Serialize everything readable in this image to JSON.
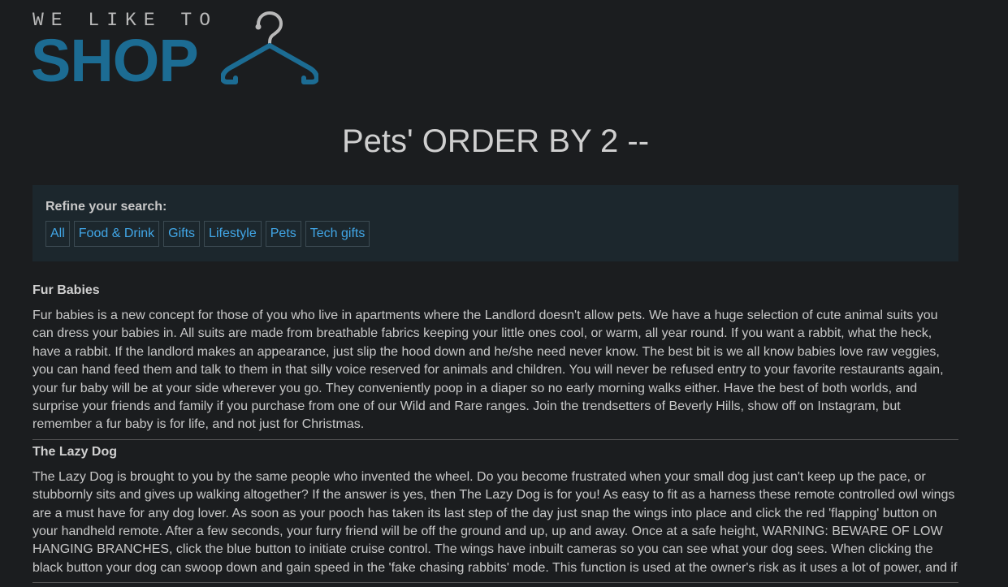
{
  "logo": {
    "tagline": "WE LIKE TO",
    "word": "SHOP"
  },
  "page_title": "Pets' ORDER BY 2 --",
  "refine": {
    "title": "Refine your search:",
    "filters": [
      "All",
      "Food & Drink",
      "Gifts",
      "Lifestyle",
      "Pets",
      "Tech gifts"
    ]
  },
  "products": [
    {
      "name": "Fur Babies",
      "description": "Fur babies is a new concept for those of you who live in apartments where the Landlord doesn't allow pets. We have a huge selection of cute animal suits you can dress your babies in. All suits are made from breathable fabrics keeping your little ones cool, or warm, all year round. If you want a rabbit, what the heck, have a rabbit. If the landlord makes an appearance, just slip the hood down and he/she need never know. The best bit is we all know babies love raw veggies, you can hand feed them and talk to them in that silly voice reserved for animals and children. You will never be refused entry to your favorite restaurants again, your fur baby will be at your side wherever you go. They conveniently poop in a diaper so no early morning walks either. Have the best of both worlds, and surprise your friends and family if you purchase from one of our Wild and Rare ranges. Join the trendsetters of Beverly Hills, show off on Instagram, but remember a fur baby is for life, and not just for Christmas."
    },
    {
      "name": "The Lazy Dog",
      "description": "The Lazy Dog is brought to you by the same people who invented the wheel. Do you become frustrated when your small dog just can't keep up the pace, or stubbornly sits and gives up walking altogether? If the answer is yes, then The Lazy Dog is for you! As easy to fit as a harness these remote controlled owl wings are a must have for any dog lover. As soon as your pooch has taken its last step of the day just snap the wings into place and click the red 'flapping' button on your handheld remote. After a few seconds, your furry friend will be off the ground and up, up and away. Once at a safe height, WARNING: BEWARE OF LOW HANGING BRANCHES, click the blue button to initiate cruise control. The wings have inbuilt cameras so you can see what your dog sees. When clicking the black button your dog can swoop down and gain speed in the 'fake chasing rabbits' mode. This function is used at the owner's risk as it uses a lot of power, and if"
    }
  ]
}
